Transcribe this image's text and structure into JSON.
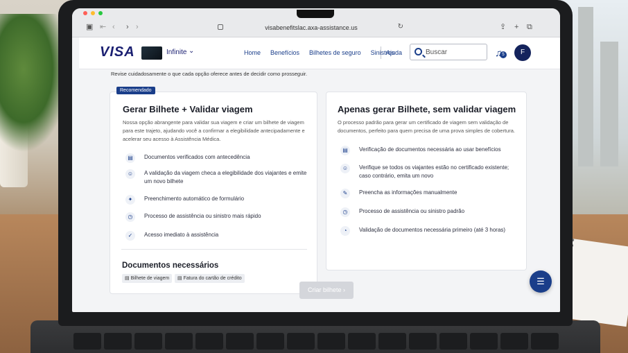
{
  "browser": {
    "url": "visabenefitslac.axa-assistance.us",
    "traffic_colors": [
      "#ff5f57",
      "#febc2e",
      "#28c840"
    ]
  },
  "header": {
    "logo": "VISA",
    "tier": "Infinite",
    "nav": [
      "Home",
      "Benefícios",
      "Bilhetes de seguro",
      "Sinistros"
    ],
    "help": "Ajuda",
    "search_placeholder": "Buscar",
    "notification_count": "5",
    "avatar_initial": "F"
  },
  "intro": "Revise cuidadosamente o que cada opção oferece antes de decidir como prosseguir.",
  "option_left": {
    "badge": "Recomendado",
    "title": "Gerar Bilhete + Validar viagem",
    "description": "Nossa opção abrangente para validar sua viagem e criar um bilhete de viagem para este trajeto, ajudando você a confirmar a elegibilidade antecipadamente e acelerar seu acesso à Assistência Médica.",
    "features": [
      {
        "icon": "document-check-icon",
        "text": "Documentos verificados com antecedência"
      },
      {
        "icon": "user-check-icon",
        "text": "A validação da viagem checa a elegibilidade dos viajantes e emite um novo bilhete"
      },
      {
        "icon": "sparkle-icon",
        "text": "Preenchimento automático de formulário"
      },
      {
        "icon": "timer-icon",
        "text": "Processo de assistência ou sinistro mais rápido"
      },
      {
        "icon": "check-circle-icon",
        "text": "Acesso imediato à assistência"
      }
    ],
    "docs_title": "Documentos necessários",
    "docs": [
      "Bilhete de viagem",
      "Fatura do cartão de crédito"
    ]
  },
  "option_right": {
    "title": "Apenas gerar Bilhete, sem validar viagem",
    "description": "O processo padrão para gerar um certificado de viagem sem validação de documentos, perfeito para quem precisa de uma prova simples de cobertura.",
    "features": [
      {
        "icon": "document-icon",
        "text": "Verificação de documentos necessária ao usar benefícios"
      },
      {
        "icon": "user-add-icon",
        "text": "Verifique se todos os viajantes estão no certificado existente; caso contrário, emita um novo"
      },
      {
        "icon": "pencil-icon",
        "text": "Preencha as informações manualmente"
      },
      {
        "icon": "clock-icon",
        "text": "Processo de assistência ou sinistro padrão"
      },
      {
        "icon": "chat-clock-icon",
        "text": "Validação de documentos necessária primeiro (até 3 horas)"
      }
    ]
  },
  "cta": "Criar bilhete",
  "colors": {
    "brand": "#1a1f71",
    "accent": "#1a3e8a",
    "disabled": "#d4d6db"
  }
}
